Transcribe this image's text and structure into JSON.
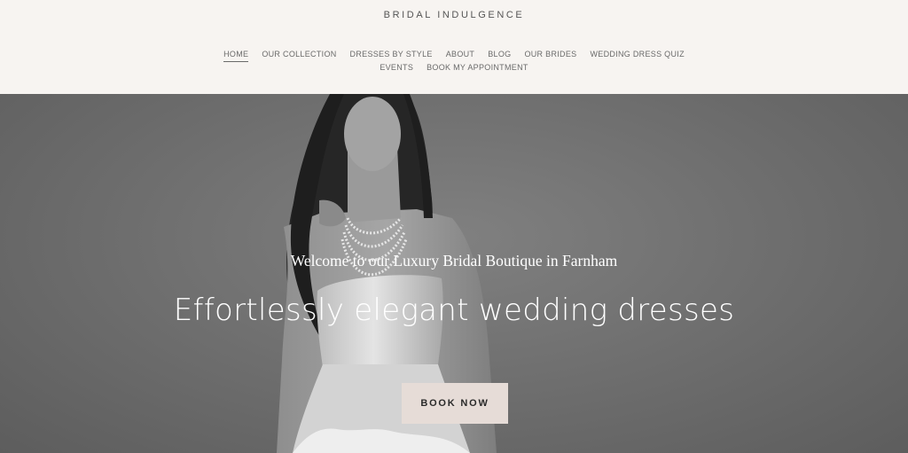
{
  "header": {
    "brand": "BRIDAL INDULGENCE",
    "nav_row1": [
      {
        "label": "HOME",
        "active": true
      },
      {
        "label": "OUR COLLECTION"
      },
      {
        "label": "DRESSES BY STYLE"
      },
      {
        "label": "ABOUT"
      },
      {
        "label": "BLOG"
      },
      {
        "label": "OUR BRIDES"
      },
      {
        "label": "WEDDING DRESS QUIZ"
      }
    ],
    "nav_row2": [
      {
        "label": "EVENTS"
      },
      {
        "label": "BOOK MY APPOINTMENT"
      }
    ]
  },
  "hero": {
    "welcome": "Welcome to our Luxury Bridal Boutique in Farnham",
    "headline": "Effortlessly elegant wedding dresses",
    "cta_label": "BOOK NOW"
  },
  "colors": {
    "header_bg": "#f7f4f1",
    "hero_bg": "#707070",
    "cta_bg": "#e6dcd7",
    "nav_text": "#6a6a6a"
  }
}
